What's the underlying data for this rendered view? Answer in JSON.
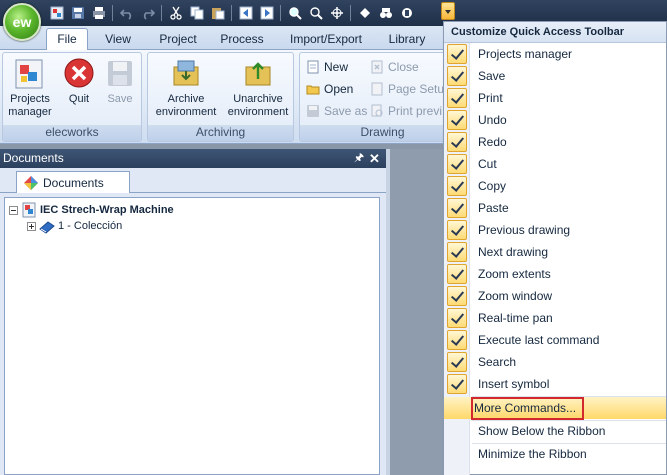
{
  "app": {
    "orb_label": "ew"
  },
  "tabs": [
    "File",
    "View",
    "Project",
    "Process",
    "Import/Export",
    "Library"
  ],
  "active_tab": "File",
  "ribbon": {
    "groups": [
      {
        "label": "elecworks",
        "buttons": [
          "Projects\nmanager",
          "Quit",
          "Save"
        ]
      },
      {
        "label": "Archiving",
        "buttons": [
          "Archive\nenvironment",
          "Unarchive\nenvironment"
        ]
      },
      {
        "label": "Drawing"
      }
    ],
    "drawing_buttons": {
      "new": "New",
      "close": "Close",
      "open": "Open",
      "page_setup": "Page Setup",
      "save_as": "Save as",
      "print_preview": "Print previ"
    }
  },
  "documents": {
    "title": "Documents",
    "tab_label": "Documents",
    "tree": {
      "root": "IEC Strech-Wrap Machine",
      "child": "1 - Colección"
    }
  },
  "menu": {
    "title": "Customize Quick Access Toolbar",
    "checked_items": [
      "Projects manager",
      "Save",
      "Print",
      "Undo",
      "Redo",
      "Cut",
      "Copy",
      "Paste",
      "Previous drawing",
      "Next drawing",
      "Zoom extents",
      "Zoom window",
      "Real-time pan",
      "Execute last command",
      "Search",
      "Insert symbol"
    ],
    "more_commands": "More Commands...",
    "show_below": "Show Below the Ribbon",
    "minimize": "Minimize the Ribbon"
  },
  "colors": {
    "title_bar": "#30435f",
    "accent_orange": "#ffd86a",
    "highlight_red": "#d4282f",
    "orb_green": "#5cb72c"
  }
}
